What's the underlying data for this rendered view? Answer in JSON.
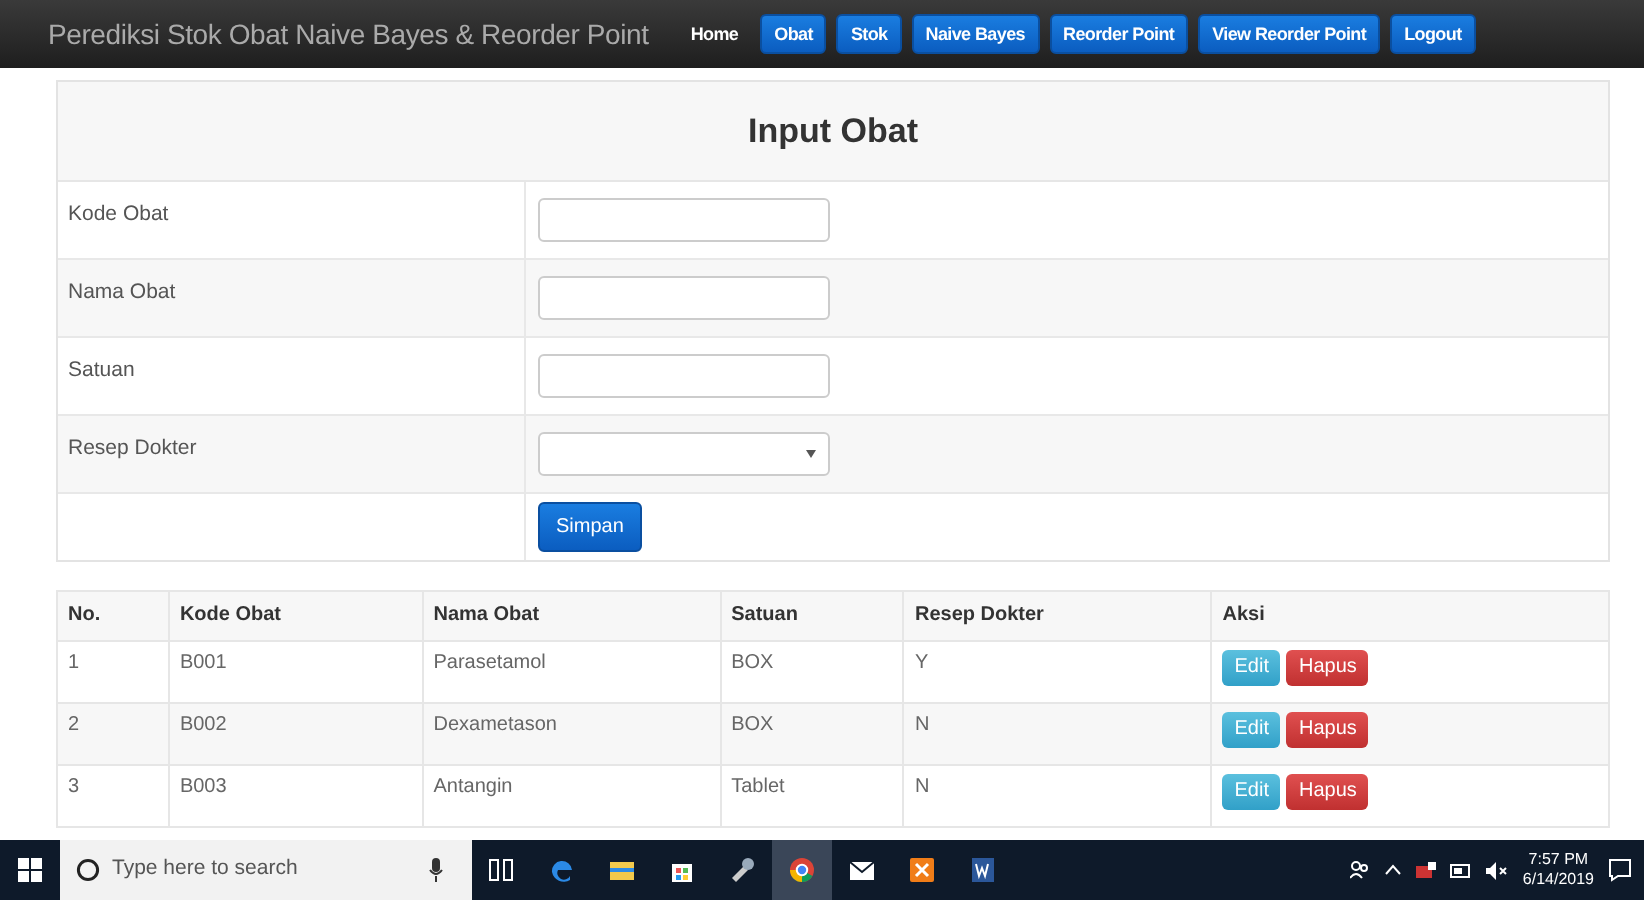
{
  "navbar": {
    "brand": "Perediksi Stok Obat Naive Bayes & Reorder Point",
    "items": [
      {
        "label": "Home",
        "selected": true
      },
      {
        "label": "Obat",
        "selected": false
      },
      {
        "label": "Stok",
        "selected": false
      },
      {
        "label": "Naive Bayes",
        "selected": false
      },
      {
        "label": "Reorder Point",
        "selected": false
      },
      {
        "label": "View Reorder Point",
        "selected": false
      },
      {
        "label": "Logout",
        "selected": false
      }
    ]
  },
  "form": {
    "title": "Input Obat",
    "fields": [
      {
        "label": "Kode Obat",
        "kind": "text"
      },
      {
        "label": "Nama Obat",
        "kind": "text"
      },
      {
        "label": "Satuan",
        "kind": "text"
      },
      {
        "label": "Resep Dokter",
        "kind": "select"
      }
    ],
    "submit": "Simpan"
  },
  "table": {
    "columns": [
      "No.",
      "Kode Obat",
      "Nama Obat",
      "Satuan",
      "Resep Dokter",
      "Aksi"
    ],
    "rows": [
      {
        "cells": [
          "1",
          "B001",
          "Parasetamol",
          "BOX",
          "Y"
        ],
        "actions": [
          "Edit",
          "Hapus"
        ]
      },
      {
        "cells": [
          "2",
          "B002",
          "Dexametason",
          "BOX",
          "N"
        ],
        "actions": [
          "Edit",
          "Hapus"
        ]
      },
      {
        "cells": [
          "3",
          "B003",
          "Antangin",
          "Tablet",
          "N"
        ],
        "actions": [
          "Edit",
          "Hapus"
        ]
      }
    ]
  },
  "taskbar": {
    "search_placeholder": "Type here to search",
    "apps": [
      {
        "kind": "taskview",
        "selected": false
      },
      {
        "kind": "edge",
        "selected": false
      },
      {
        "kind": "files",
        "selected": false
      },
      {
        "kind": "store",
        "selected": false
      },
      {
        "kind": "tool",
        "selected": false
      },
      {
        "kind": "chrome",
        "selected": true
      },
      {
        "kind": "mail",
        "selected": false
      },
      {
        "kind": "xampp",
        "selected": false
      },
      {
        "kind": "word",
        "selected": false
      }
    ],
    "time": "7:57 PM",
    "date": "6/14/2019"
  }
}
